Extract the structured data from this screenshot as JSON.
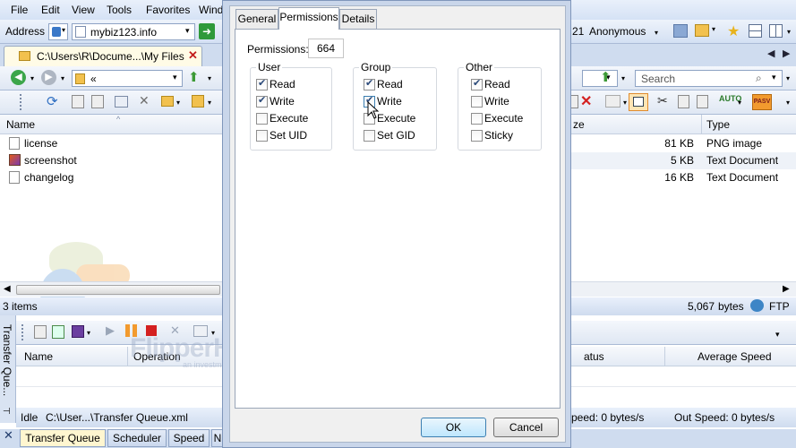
{
  "menu": [
    "File",
    "Edit",
    "View",
    "Tools",
    "Favorites",
    "Wind"
  ],
  "address": {
    "label": "Address",
    "value": "mybiz123.info"
  },
  "login": {
    "port_partial": "21",
    "user": "Anonymous"
  },
  "local_tab": {
    "path": "C:\\Users\\R\\Docume...\\My Files"
  },
  "local_nav": {
    "path": "«"
  },
  "search": {
    "placeholder": "Search"
  },
  "columns": {
    "name": "Name",
    "size": "ze",
    "type": "Type"
  },
  "files": [
    {
      "name": "license",
      "size": "81 KB",
      "type": "PNG image"
    },
    {
      "name": "screenshot",
      "size": "5 KB",
      "type": "Text Document"
    },
    {
      "name": "changelog",
      "size": "16 KB",
      "type": "Text Document"
    }
  ],
  "status_left": "3 items",
  "status_right": {
    "bytes": "5,067",
    "bytes_unit": "bytes",
    "protocol": "FTP"
  },
  "queue": {
    "vertical_label": "Transfer Que...",
    "columns": {
      "name": "Name",
      "operation": "Operation",
      "status": "atus",
      "avg_speed": "Average Speed"
    },
    "status_bar": {
      "state": "Idle",
      "path": "C:\\User...\\Transfer Queue.xml",
      "in_speed": "peed: 0 bytes/s",
      "out_speed": "Out Speed: 0 bytes/s"
    },
    "tabs": [
      "Transfer Queue",
      "Scheduler",
      "Speed",
      "N"
    ]
  },
  "dialog": {
    "tabs": [
      "General",
      "Permissions",
      "Details"
    ],
    "active_tab": "Permissions",
    "permissions_label": "Permissions:",
    "permissions_value": "664",
    "groups": [
      {
        "title": "User",
        "options": [
          {
            "label": "Read",
            "checked": true
          },
          {
            "label": "Write",
            "checked": true
          },
          {
            "label": "Execute",
            "checked": false
          },
          {
            "label": "Set UID",
            "checked": false
          }
        ]
      },
      {
        "title": "Group",
        "options": [
          {
            "label": "Read",
            "checked": true
          },
          {
            "label": "Write",
            "checked": true
          },
          {
            "label": "Execute",
            "checked": false
          },
          {
            "label": "Set GID",
            "checked": false
          }
        ]
      },
      {
        "title": "Other",
        "options": [
          {
            "label": "Read",
            "checked": true
          },
          {
            "label": "Write",
            "checked": false
          },
          {
            "label": "Execute",
            "checked": false
          },
          {
            "label": "Sticky",
            "checked": false
          }
        ]
      }
    ],
    "ok_label": "OK",
    "cancel_label": "Cancel"
  },
  "watermark": {
    "brand": "FlipperHost",
    "tagline": "an investment company"
  },
  "colors": {
    "accent": "#3c7fb1",
    "frame": "#cfdcef",
    "tab_highlight": "#fff6d0"
  }
}
